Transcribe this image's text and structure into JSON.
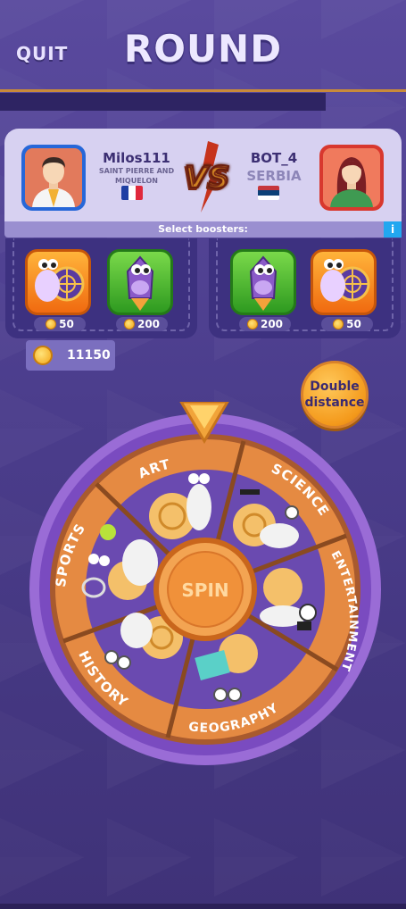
{
  "header": {
    "quit_label": "QUIT",
    "title": "ROUND"
  },
  "players": {
    "left": {
      "name": "Milos111",
      "country_line1": "SAINT PIERRE AND",
      "country_line2": "MIQUELON",
      "flag": "france-flag"
    },
    "vs_label": "VS",
    "right": {
      "name": "BOT_4",
      "country": "SERBIA",
      "flag": "serbia-flag"
    },
    "select_boosters_label": "Select boosters:",
    "info_label": "i"
  },
  "boosters_left": [
    {
      "icon": "snail-target-icon",
      "price": "50",
      "color": "orange"
    },
    {
      "icon": "snail-rocket-icon",
      "price": "200",
      "color": "green"
    }
  ],
  "boosters_right": [
    {
      "icon": "snail-rocket-icon",
      "price": "200",
      "color": "green"
    },
    {
      "icon": "snail-target-icon",
      "price": "50",
      "color": "orange"
    }
  ],
  "balance": "11150",
  "double_distance_label": "Double distance",
  "wheel": {
    "spin_label": "SPIN",
    "categories": [
      "ART",
      "SCIENCE",
      "ENTERTAINMENT",
      "GEOGRAPHY",
      "HISTORY",
      "SPORTS"
    ]
  },
  "colors": {
    "accent_orange": "#f49a1c",
    "panel_purple": "#3d3180",
    "card_lavender": "#d7d1f1"
  }
}
